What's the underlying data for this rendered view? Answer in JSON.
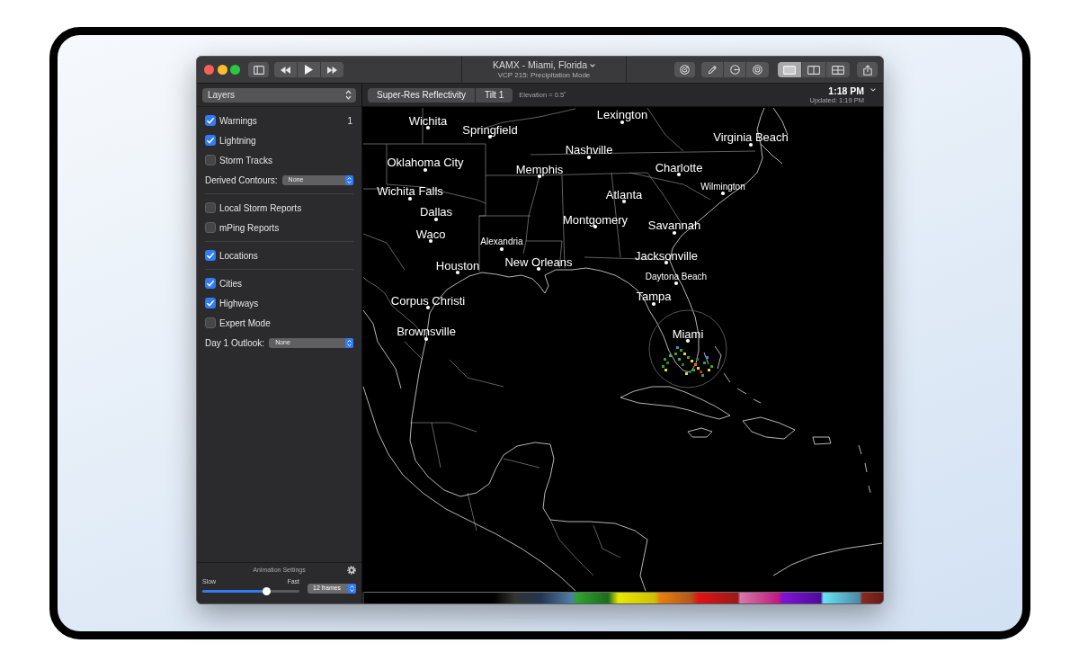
{
  "window": {
    "title": "KAMX - Miami, Florida",
    "subtitle": "VCP 215: Precipitation Mode"
  },
  "toolbar": {
    "layout_buttons": [
      {
        "kind": "single",
        "selected": true
      },
      {
        "kind": "columns",
        "selected": false
      },
      {
        "kind": "grid",
        "selected": false
      }
    ]
  },
  "sidebar": {
    "popup": "Layers",
    "sections": [
      {
        "items": [
          {
            "kind": "checkbox",
            "label": "Warnings",
            "checked": true,
            "count": "1"
          },
          {
            "kind": "checkbox",
            "label": "Lightning",
            "checked": true
          },
          {
            "kind": "checkbox",
            "label": "Storm Tracks",
            "checked": false
          },
          {
            "kind": "popup",
            "label": "Derived Contours:",
            "value": "None"
          }
        ]
      },
      {
        "items": [
          {
            "kind": "checkbox",
            "label": "Local Storm Reports",
            "checked": false
          },
          {
            "kind": "checkbox",
            "label": "mPing Reports",
            "checked": false
          }
        ]
      },
      {
        "items": [
          {
            "kind": "checkbox",
            "label": "Locations",
            "checked": true
          }
        ]
      },
      {
        "items": [
          {
            "kind": "checkbox",
            "label": "Cities",
            "checked": true
          },
          {
            "kind": "checkbox",
            "label": "Highways",
            "checked": true
          },
          {
            "kind": "checkbox",
            "label": "Expert Mode",
            "checked": false
          },
          {
            "kind": "popup",
            "label": "Day 1 Outlook:",
            "value": "None"
          }
        ]
      }
    ],
    "animation": {
      "title": "Animation Settings",
      "slow_label": "Slow",
      "fast_label": "Fast",
      "speed": {
        "level": 0.66
      },
      "frames": "12 frames"
    }
  },
  "map": {
    "products": [
      "Super-Res Reflectivity",
      "Tilt 1"
    ],
    "elevation": "Elevation = 0.5˚",
    "time": "1:18 PM",
    "updated": "Updated: 1:19 PM",
    "cities": [
      {
        "name": "Wichita",
        "kind": "large"
      },
      {
        "name": "Lexington",
        "kind": "large"
      },
      {
        "name": "Springfield",
        "kind": "large"
      },
      {
        "name": "Virginia Beach",
        "kind": "large"
      },
      {
        "name": "Nashville",
        "kind": "large"
      },
      {
        "name": "Oklahoma City",
        "kind": "large"
      },
      {
        "name": "Memphis",
        "kind": "large"
      },
      {
        "name": "Charlotte",
        "kind": "large"
      },
      {
        "name": "Wichita Falls",
        "kind": "large"
      },
      {
        "name": "Atlanta",
        "kind": "large"
      },
      {
        "name": "Wilmington",
        "kind": "small"
      },
      {
        "name": "Dallas",
        "kind": "large"
      },
      {
        "name": "Montgomery",
        "kind": "large"
      },
      {
        "name": "Savannah",
        "kind": "large"
      },
      {
        "name": "Waco",
        "kind": "large"
      },
      {
        "name": "Alexandria",
        "kind": "small"
      },
      {
        "name": "Houston",
        "kind": "large"
      },
      {
        "name": "New Orleans",
        "kind": "large"
      },
      {
        "name": "Jacksonville",
        "kind": "large"
      },
      {
        "name": "Daytona Beach",
        "kind": "small"
      },
      {
        "name": "Corpus Christi",
        "kind": "large"
      },
      {
        "name": "Tampa",
        "kind": "large"
      },
      {
        "name": "Brownsville",
        "kind": "large"
      },
      {
        "name": "Miami",
        "kind": "large"
      }
    ]
  }
}
